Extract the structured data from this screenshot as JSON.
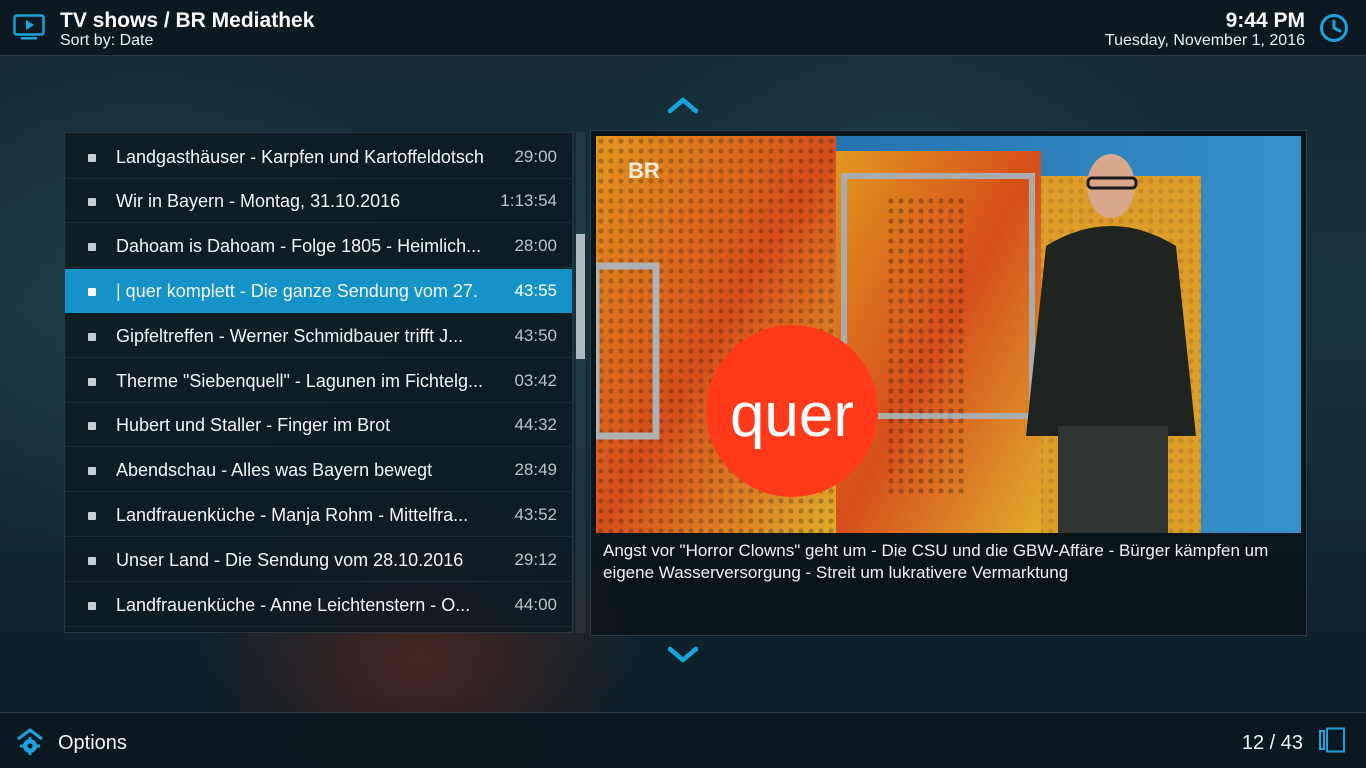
{
  "header": {
    "title": "TV shows / BR Mediathek",
    "sort": "Sort by: Date",
    "time": "9:44 PM",
    "date": "Tuesday, November 1, 2016"
  },
  "list": {
    "items": [
      {
        "label": "Landgasthäuser - Karpfen und Kartoffeldotsch",
        "duration": "29:00"
      },
      {
        "label": "Wir in Bayern - Montag, 31.10.2016",
        "duration": "1:13:54"
      },
      {
        "label": "Dahoam is Dahoam - Folge 1805 - Heimlich...",
        "duration": "28:00"
      },
      {
        "label": "| quer komplett - Die ganze Sendung vom 27.",
        "duration": "43:55"
      },
      {
        "label": "Gipfeltreffen - Werner Schmidbauer trifft J...",
        "duration": "43:50"
      },
      {
        "label": "Therme \"Siebenquell\" - Lagunen im Fichtelg...",
        "duration": "03:42"
      },
      {
        "label": "Hubert und Staller - Finger im Brot",
        "duration": "44:32"
      },
      {
        "label": "Abendschau - Alles was Bayern bewegt",
        "duration": "28:49"
      },
      {
        "label": "Landfrauenküche - Manja Rohm - Mittelfra...",
        "duration": "43:52"
      },
      {
        "label": "Unser Land - Die Sendung vom 28.10.2016",
        "duration": "29:12"
      },
      {
        "label": "Landfrauenküche - Anne Leichtenstern - O...",
        "duration": "44:00"
      }
    ],
    "selected_index": 3
  },
  "info": {
    "thumbnail_logo": "quer",
    "channel_logo": "BR",
    "plot": "Angst vor \"Horror Clowns\" geht um - Die CSU und die GBW-Affäre - Bürger kämpfen um eigene Wasserversorgung - Streit um lukrativere Vermarktung"
  },
  "footer": {
    "options_label": "Options",
    "counter": "12 / 43"
  },
  "colors": {
    "accent": "#1593c8",
    "icon": "#1aa3dc",
    "quer_red": "#ff3a1a"
  }
}
